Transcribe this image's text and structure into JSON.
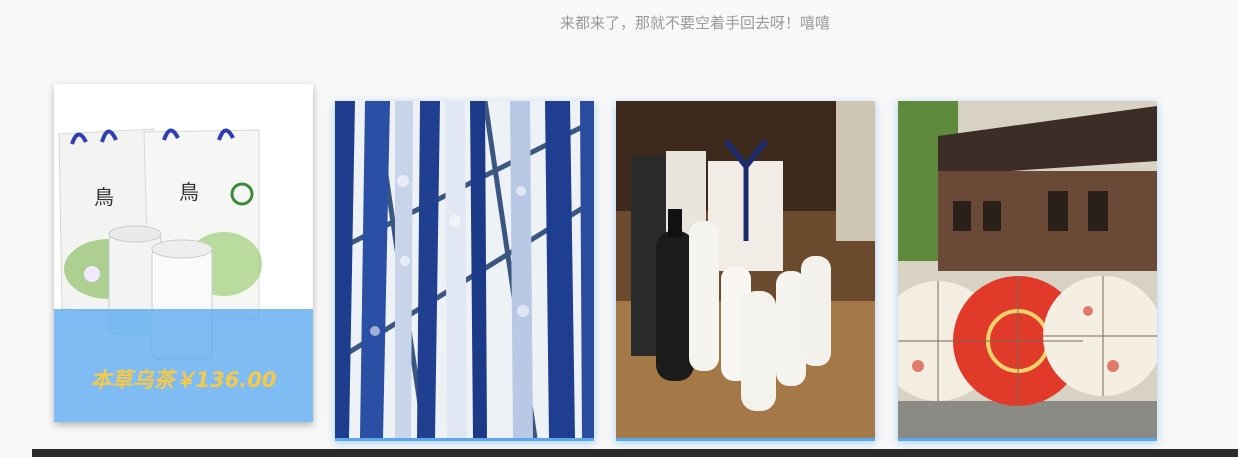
{
  "subtitle": "来都来了，那就不要空着手回去呀！嘻嘻",
  "products": [
    {
      "name": "本草乌茶",
      "price": "￥136.00",
      "image": "tea-gift-bag",
      "active": true
    },
    {
      "name": "",
      "price": "",
      "image": "blue-white-cloth",
      "active": false
    },
    {
      "name": "",
      "price": "",
      "image": "liquor-bottles",
      "active": false
    },
    {
      "name": "",
      "price": "",
      "image": "oil-paper-umbrellas",
      "active": false
    }
  ],
  "colors": {
    "overlay": "#5aa9f0",
    "price_text": "#f5c84a",
    "subtitle": "#9a9a9a",
    "accent_border": "#5aa9f0"
  }
}
